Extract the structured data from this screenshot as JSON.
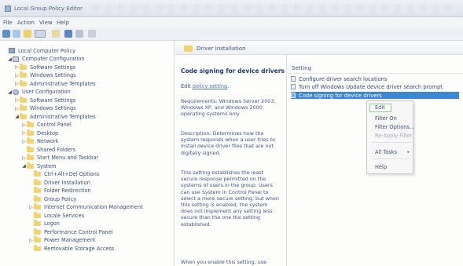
{
  "window": {
    "title": "Local Group Policy Editor"
  },
  "menu": [
    "File",
    "Action",
    "View",
    "Help"
  ],
  "tree": [
    {
      "label": "Local Computer Policy",
      "depth": 0,
      "icon": "policy-icon",
      "twist": ""
    },
    {
      "label": "Computer Configuration",
      "depth": 1,
      "icon": "computer-icon",
      "twist": "◢"
    },
    {
      "label": "Software Settings",
      "depth": 2,
      "icon": "folder-icon",
      "twist": "▷"
    },
    {
      "label": "Windows Settings",
      "depth": 2,
      "icon": "folder-icon",
      "twist": "▷"
    },
    {
      "label": "Administrative Templates",
      "depth": 2,
      "icon": "folder-icon",
      "twist": "▷"
    },
    {
      "label": "User Configuration",
      "depth": 1,
      "icon": "user-icon",
      "twist": "◢"
    },
    {
      "label": "Software Settings",
      "depth": 2,
      "icon": "folder-icon",
      "twist": "▷"
    },
    {
      "label": "Windows Settings",
      "depth": 2,
      "icon": "folder-icon",
      "twist": "▷"
    },
    {
      "label": "Administrative Templates",
      "depth": 2,
      "icon": "folder-icon",
      "twist": "◢"
    },
    {
      "label": "Control Panel",
      "depth": 3,
      "icon": "folder-icon",
      "twist": "▷"
    },
    {
      "label": "Desktop",
      "depth": 3,
      "icon": "folder-icon",
      "twist": "▷"
    },
    {
      "label": "Network",
      "depth": 3,
      "icon": "folder-icon",
      "twist": "▷"
    },
    {
      "label": "Shared Folders",
      "depth": 3,
      "icon": "folder-icon",
      "twist": ""
    },
    {
      "label": "Start Menu and Taskbar",
      "depth": 3,
      "icon": "folder-icon",
      "twist": "▷"
    },
    {
      "label": "System",
      "depth": 3,
      "icon": "folder-icon",
      "twist": "◢"
    },
    {
      "label": "Ctrl+Alt+Del Options",
      "depth": 4,
      "icon": "folder-icon",
      "twist": ""
    },
    {
      "label": "Driver Installation",
      "depth": 4,
      "icon": "folder-icon",
      "twist": ""
    },
    {
      "label": "Folder Redirection",
      "depth": 4,
      "icon": "folder-icon",
      "twist": ""
    },
    {
      "label": "Group Policy",
      "depth": 4,
      "icon": "folder-icon",
      "twist": ""
    },
    {
      "label": "Internet Communication Management",
      "depth": 4,
      "icon": "folder-icon",
      "twist": "▷"
    },
    {
      "label": "Locale Services",
      "depth": 4,
      "icon": "folder-icon",
      "twist": ""
    },
    {
      "label": "Logon",
      "depth": 4,
      "icon": "folder-icon",
      "twist": ""
    },
    {
      "label": "Performance Control Panel",
      "depth": 4,
      "icon": "folder-icon",
      "twist": ""
    },
    {
      "label": "Power Management",
      "depth": 4,
      "icon": "folder-icon",
      "twist": "▷"
    },
    {
      "label": "Removable Storage Access",
      "depth": 4,
      "icon": "folder-icon",
      "twist": ""
    }
  ],
  "category": "Driver Installation",
  "description": {
    "title": "Code signing for device drivers",
    "edit_prefix": "Edit ",
    "edit_link": "policy setting",
    "edit_suffix": ".",
    "requirements": "Requirements: Windows Server 2003, Windows XP, and Windows 2000 operating systems only",
    "description": "Description: Determines how the system responds when a user tries to install device driver files that are not digitally signed.",
    "body1": "This setting establishes the least secure response permitted on the systems of users in the group. Users can use System in Control Panel to select a more secure setting, but when this setting is enabled, the system does not implement any setting less secure than the one the setting established.",
    "body2": "When you enable this setting, use"
  },
  "settings": {
    "column_header": "Setting",
    "rows": [
      "Configure driver search locations",
      "Turn off Windows Update device driver search prompt",
      "Code signing for device drivers"
    ]
  },
  "context_menu": {
    "items": [
      "Edit",
      "Filter On",
      "Filter Options...",
      "Re-Apply Filter",
      "All Tasks",
      "Help"
    ],
    "submenu_arrow": "▸"
  }
}
